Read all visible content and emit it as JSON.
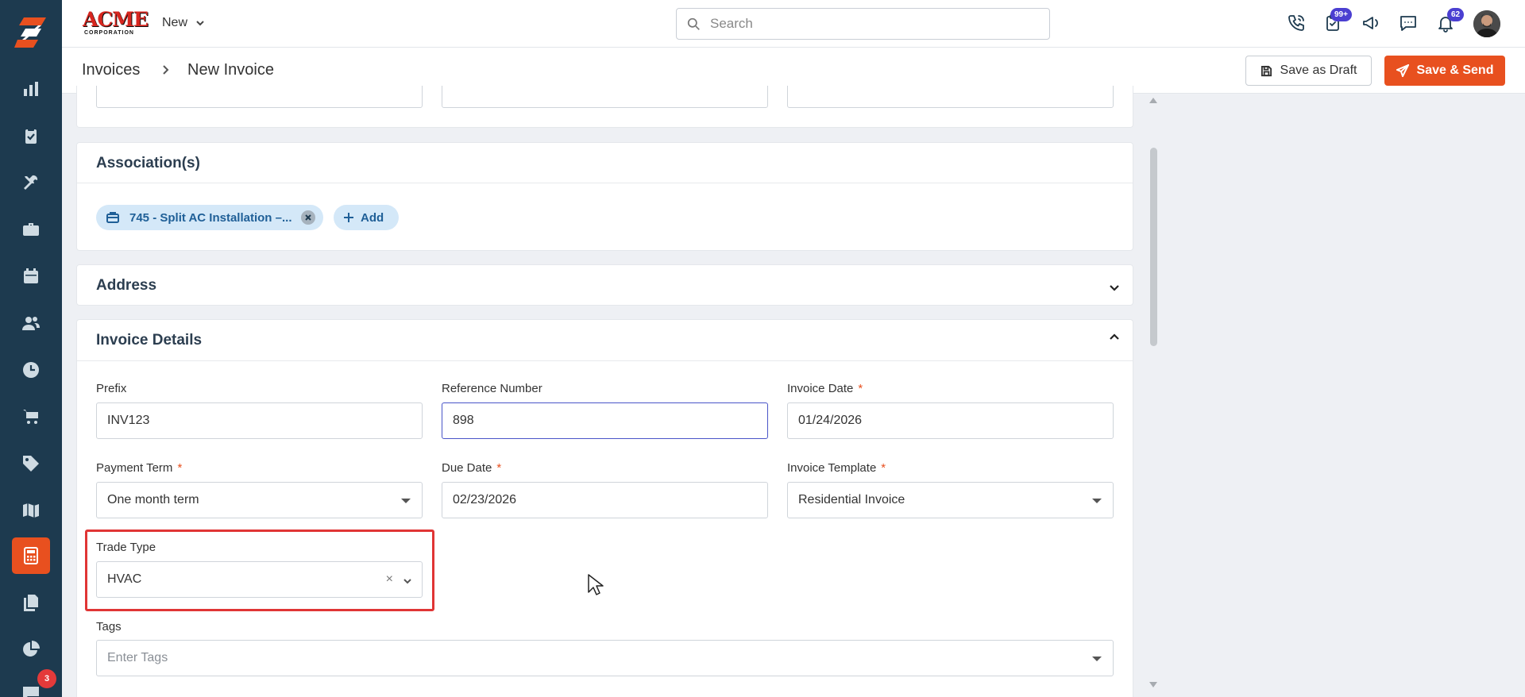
{
  "app": {
    "brand": "ACME",
    "brand_sub": "CORPORATION",
    "new_menu_label": "New"
  },
  "search": {
    "placeholder": "Search"
  },
  "header_badges": {
    "tasks": "99+",
    "notifications": "62"
  },
  "sidebar": {
    "items": [
      "reports",
      "tasks",
      "tools",
      "jobs",
      "calendar",
      "customers",
      "timesheet",
      "shop",
      "pricebook",
      "map",
      "invoices",
      "documents",
      "analytics",
      "chat"
    ],
    "active": "invoices",
    "chat_badge": "3"
  },
  "breadcrumb": {
    "parent": "Invoices",
    "current": "New Invoice"
  },
  "actions": {
    "save_draft": "Save as Draft",
    "save_send": "Save & Send"
  },
  "associations": {
    "title": "Association(s)",
    "chip_label": "745 - Split AC Installation –...",
    "add_label": "Add"
  },
  "address": {
    "title": "Address"
  },
  "invoice_details": {
    "title": "Invoice Details",
    "prefix": {
      "label": "Prefix",
      "value": "INV123"
    },
    "reference_number": {
      "label": "Reference Number",
      "value": "898"
    },
    "invoice_date": {
      "label": "Invoice Date",
      "value": "01/24/2026",
      "required": "*"
    },
    "payment_term": {
      "label": "Payment Term",
      "value": "One month term",
      "required": "*"
    },
    "due_date": {
      "label": "Due Date",
      "value": "02/23/2026",
      "required": "*"
    },
    "invoice_template": {
      "label": "Invoice Template",
      "value": "Residential Invoice",
      "required": "*"
    },
    "trade_type": {
      "label": "Trade Type",
      "value": "HVAC",
      "clear": "×"
    },
    "tags": {
      "label": "Tags",
      "placeholder": "Enter Tags"
    }
  },
  "colors": {
    "sidebar_bg": "#1d3a4f",
    "accent": "#e8501f",
    "badge": "#4b3fd1",
    "highlight": "#e03535"
  }
}
